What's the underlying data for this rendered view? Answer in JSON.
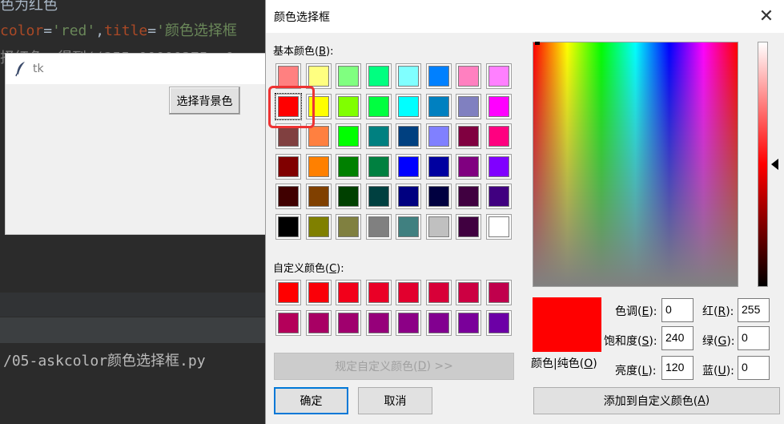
{
  "ide": {
    "line1": "色为红色",
    "line2_a": "color",
    "line2_b": "=",
    "line2_c": "'red'",
    "line2_d": ",",
    "line2_e": "title",
    "line2_f": "=",
    "line2_g": "'颜色选择框",
    "line3": "择红色，得到((255.00000375, 0",
    "path": "/05-askcolor颜色选择框.py"
  },
  "tk": {
    "title": "tk",
    "button_label": "选择背景色"
  },
  "dialog": {
    "title": "颜色选择框",
    "close_glyph": "✕",
    "basic_label": "基本颜色(",
    "basic_key": "B",
    "basic_label_end": "):",
    "custom_label": "自定义颜色(",
    "custom_key": "C",
    "custom_label_end": "):",
    "define_custom_label": "规定自定义颜色(",
    "define_custom_key": "D",
    "define_custom_end": ") >>",
    "ok_label": "确定",
    "cancel_label": "取消",
    "add_custom_label": "添加到自定义颜色(",
    "add_custom_key": "A",
    "add_custom_end": ")",
    "color_solid_label": "颜色|纯色(",
    "color_solid_key": "O",
    "color_solid_end": ")",
    "fields": {
      "hue": {
        "label": "色调(",
        "key": "E",
        "end": "):",
        "value": "0"
      },
      "sat": {
        "label": "饱和度(",
        "key": "S",
        "end": "):",
        "value": "240"
      },
      "lum": {
        "label": "亮度(",
        "key": "L",
        "end": "):",
        "value": "120"
      },
      "red": {
        "label": "红(",
        "key": "R",
        "end": "):",
        "value": "255"
      },
      "green": {
        "label": "绿(",
        "key": "G",
        "end": "):",
        "value": "0"
      },
      "blue": {
        "label": "蓝(",
        "key": "U",
        "end": "):",
        "value": "0"
      }
    },
    "preview_color": "#ff0000",
    "basic_colors": [
      "#ff8080",
      "#ffff80",
      "#80ff80",
      "#00ff80",
      "#80ffff",
      "#0080ff",
      "#ff80c0",
      "#ff80ff",
      "#ff0000",
      "#ffff00",
      "#80ff00",
      "#00ff40",
      "#00ffff",
      "#0080c0",
      "#8080c0",
      "#ff00ff",
      "#804040",
      "#ff8040",
      "#00ff00",
      "#008080",
      "#004080",
      "#8080ff",
      "#800040",
      "#ff0080",
      "#800000",
      "#ff8000",
      "#008000",
      "#008040",
      "#0000ff",
      "#0000a0",
      "#800080",
      "#8000ff",
      "#400000",
      "#804000",
      "#004000",
      "#004040",
      "#000080",
      "#000040",
      "#400040",
      "#400080",
      "#000000",
      "#808000",
      "#808040",
      "#808080",
      "#408080",
      "#c0c0c0",
      "#400040",
      "#ffffff"
    ],
    "custom_colors": [
      "#ff0000",
      "#fa0008",
      "#f2001a",
      "#ea0026",
      "#e2002e",
      "#d80038",
      "#cc0042",
      "#c0004c",
      "#b4005a",
      "#a80064",
      "#a0006e",
      "#96007a",
      "#8c0086",
      "#820090",
      "#7a009a",
      "#6c00a6"
    ]
  }
}
